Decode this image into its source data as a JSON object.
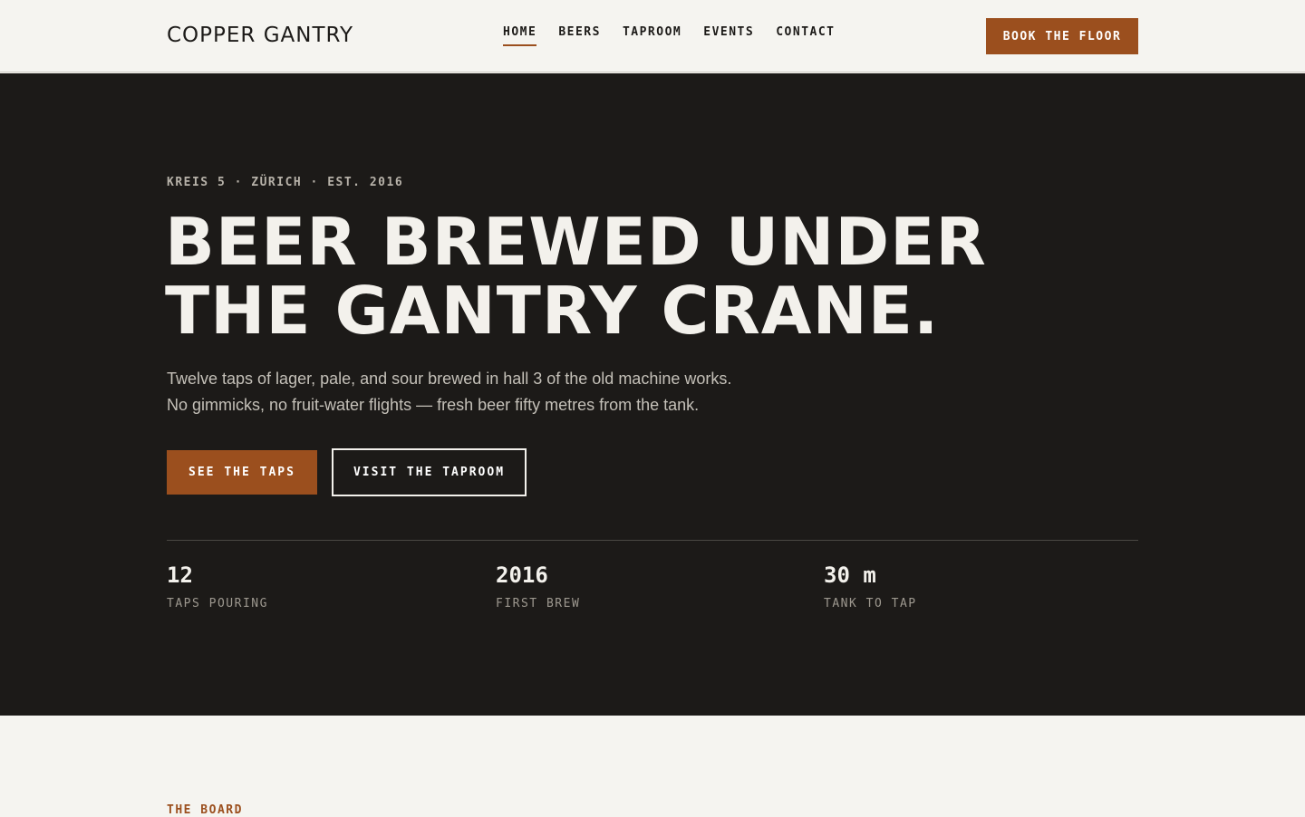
{
  "header": {
    "logo": "COPPER GANTRY",
    "nav": [
      {
        "label": "HOME",
        "active": true
      },
      {
        "label": "BEERS",
        "active": false
      },
      {
        "label": "TAPROOM",
        "active": false
      },
      {
        "label": "EVENTS",
        "active": false
      },
      {
        "label": "CONTACT",
        "active": false
      }
    ],
    "cta": "BOOK THE FLOOR"
  },
  "hero": {
    "eyebrow": "KREIS 5 · ZÜRICH · EST. 2016",
    "headline": [
      "BEER BREWED UNDER",
      "THE GANTRY CRANE."
    ],
    "lede": [
      "Twelve taps of lager, pale, and sour brewed in hall 3 of the old machine works.",
      "No gimmicks, no fruit-water flights — fresh beer fifty metres from the tank."
    ],
    "primary_button": "SEE THE TAPS",
    "secondary_button": "VISIT THE TAPROOM",
    "stats": [
      {
        "value": "12",
        "label": "TAPS POURING"
      },
      {
        "value": "2016",
        "label": "FIRST BREW"
      },
      {
        "value": "30 m",
        "label": "TANK TO TAP"
      }
    ]
  },
  "board": {
    "eyebrow": "THE BOARD"
  },
  "colors": {
    "accent": "#9b4f1e",
    "hero_background": "#1c1a18",
    "page_background": "#f5f4f0"
  }
}
